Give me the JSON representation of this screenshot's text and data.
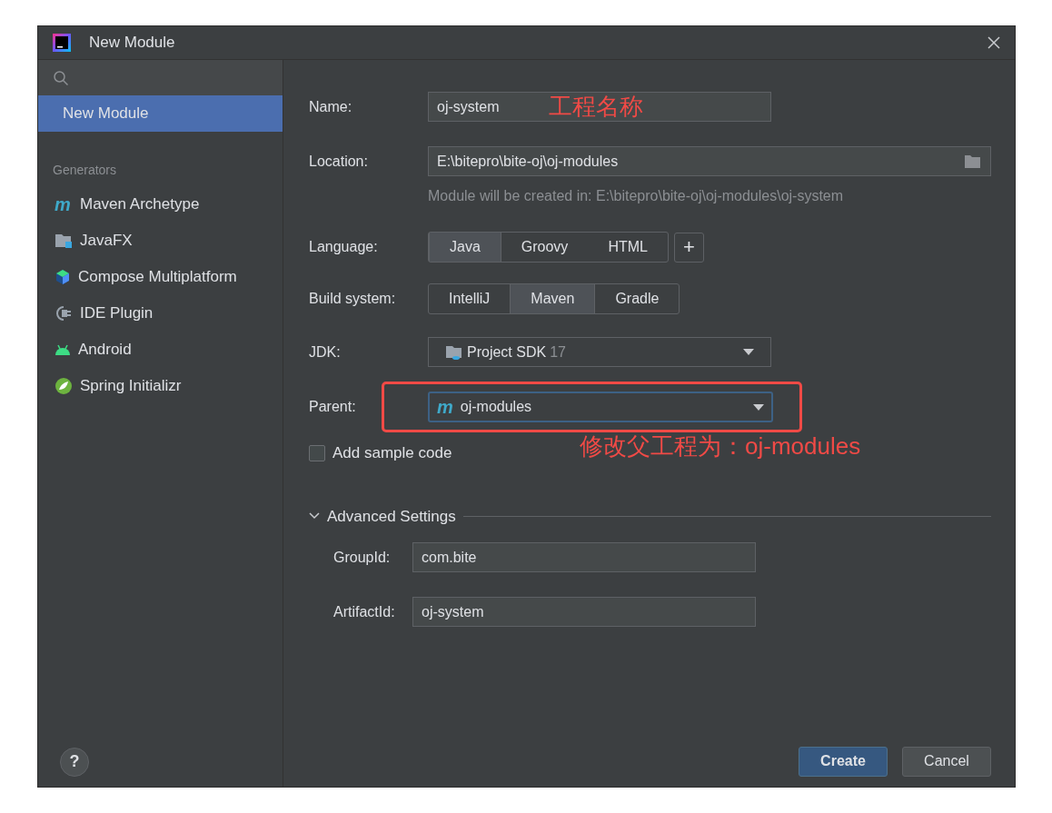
{
  "window": {
    "title": "New Module"
  },
  "sidebar": {
    "items": [
      {
        "label": "New Module",
        "selected": true
      }
    ],
    "section": "Generators",
    "generators": [
      {
        "label": "Maven Archetype",
        "kind": "maven",
        "icon": "m",
        "selected": false
      },
      {
        "label": "JavaFX",
        "kind": "javafx",
        "selected": false
      },
      {
        "label": "Compose Multiplatform",
        "kind": "compose",
        "selected": false
      },
      {
        "label": "IDE Plugin",
        "kind": "plugin",
        "selected": false
      },
      {
        "label": "Android",
        "kind": "android",
        "selected": false
      },
      {
        "label": "Spring Initializr",
        "kind": "spring",
        "selected": false
      }
    ]
  },
  "form": {
    "name": {
      "label": "Name:",
      "value": "oj-system",
      "annotation": "工程名称"
    },
    "location": {
      "label": "Location:",
      "value": "E:\\bitepro\\bite-oj\\oj-modules",
      "hint": "Module will be created in: E:\\bitepro\\bite-oj\\oj-modules\\oj-system"
    },
    "language": {
      "label": "Language:",
      "options": [
        {
          "label": "Java",
          "selected": true
        },
        {
          "label": "Groovy",
          "selected": false
        },
        {
          "label": "HTML",
          "selected": false
        }
      ],
      "add": "+"
    },
    "build_system": {
      "label": "Build system:",
      "options": [
        {
          "label": "IntelliJ",
          "selected": false
        },
        {
          "label": "Maven",
          "selected": true
        },
        {
          "label": "Gradle",
          "selected": false
        }
      ]
    },
    "jdk": {
      "label": "JDK:",
      "value": "Project SDK",
      "version": "17"
    },
    "parent": {
      "label": "Parent:",
      "value": "oj-modules",
      "icon": "m",
      "highlighted": true,
      "annotation": "修改父工程为：oj-modules"
    },
    "sample_code": {
      "label": "Add sample code",
      "checked": false
    },
    "advanced": {
      "title": "Advanced Settings",
      "expanded": true,
      "fields": [
        {
          "label": "GroupId:",
          "value": "com.bite"
        },
        {
          "label": "ArtifactId:",
          "value": "oj-system"
        }
      ]
    }
  },
  "buttons": [
    {
      "label": "Create",
      "kind": "primary"
    },
    {
      "label": "Cancel",
      "kind": "secondary"
    }
  ],
  "help": "?"
}
